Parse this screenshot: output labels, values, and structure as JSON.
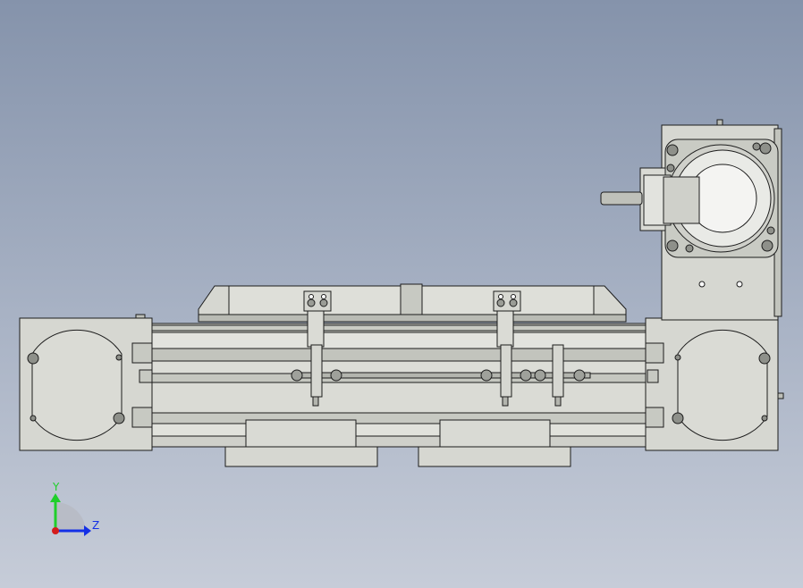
{
  "colors": {
    "body": "#d6d7d1",
    "bodyDark": "#b9bbb4",
    "edge": "#1c1c1c",
    "axisY": "#1fcf2a",
    "axisZ": "#1430e6",
    "axisX": "#d41c1c"
  },
  "triad": {
    "y_label": "Y",
    "z_label": "Z"
  }
}
